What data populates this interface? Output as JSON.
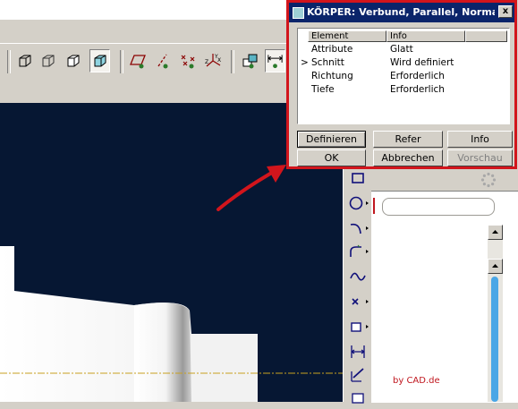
{
  "dialog": {
    "title": "KÖRPER: Verbund, Parallel, Normale...",
    "close_label": "x",
    "columns": [
      "Element",
      "Info"
    ],
    "rows": [
      {
        "marker": "",
        "element": "Attribute",
        "info": "Glatt"
      },
      {
        "marker": ">",
        "element": "Schnitt",
        "info": "Wird definiert"
      },
      {
        "marker": "",
        "element": "Richtung",
        "info": "Erforderlich"
      },
      {
        "marker": "",
        "element": "Tiefe",
        "info": "Erforderlich"
      }
    ],
    "buttons": {
      "definieren": "Definieren",
      "refer": "Refer",
      "info": "Info",
      "ok": "OK",
      "abbrechen": "Abbrechen",
      "vorschau": "Vorschau"
    }
  },
  "credit": "by CAD.de",
  "colors": {
    "highlight_border": "#d2151c",
    "arrow": "#d2151c",
    "graphics_background": "#061733",
    "title_bar": "#0a246a",
    "datum_line": "#c8a020"
  },
  "icons": {
    "toolbar": [
      "box-view-icon",
      "box-view-icon",
      "box-view-icon",
      "shaded-box-icon",
      "datum-plane-icon",
      "datum-axis-icon",
      "datum-point-icon",
      "coordinate-system-icon",
      "layer-icon",
      "dimension-icon"
    ],
    "vertical_toolbar": [
      "rectangle-icon",
      "circle-icon",
      "arc-icon",
      "fillet-icon",
      "spline-icon",
      "point-icon",
      "offset-icon",
      "dimension-icon",
      "modify-icon",
      "constraint-icon"
    ]
  }
}
